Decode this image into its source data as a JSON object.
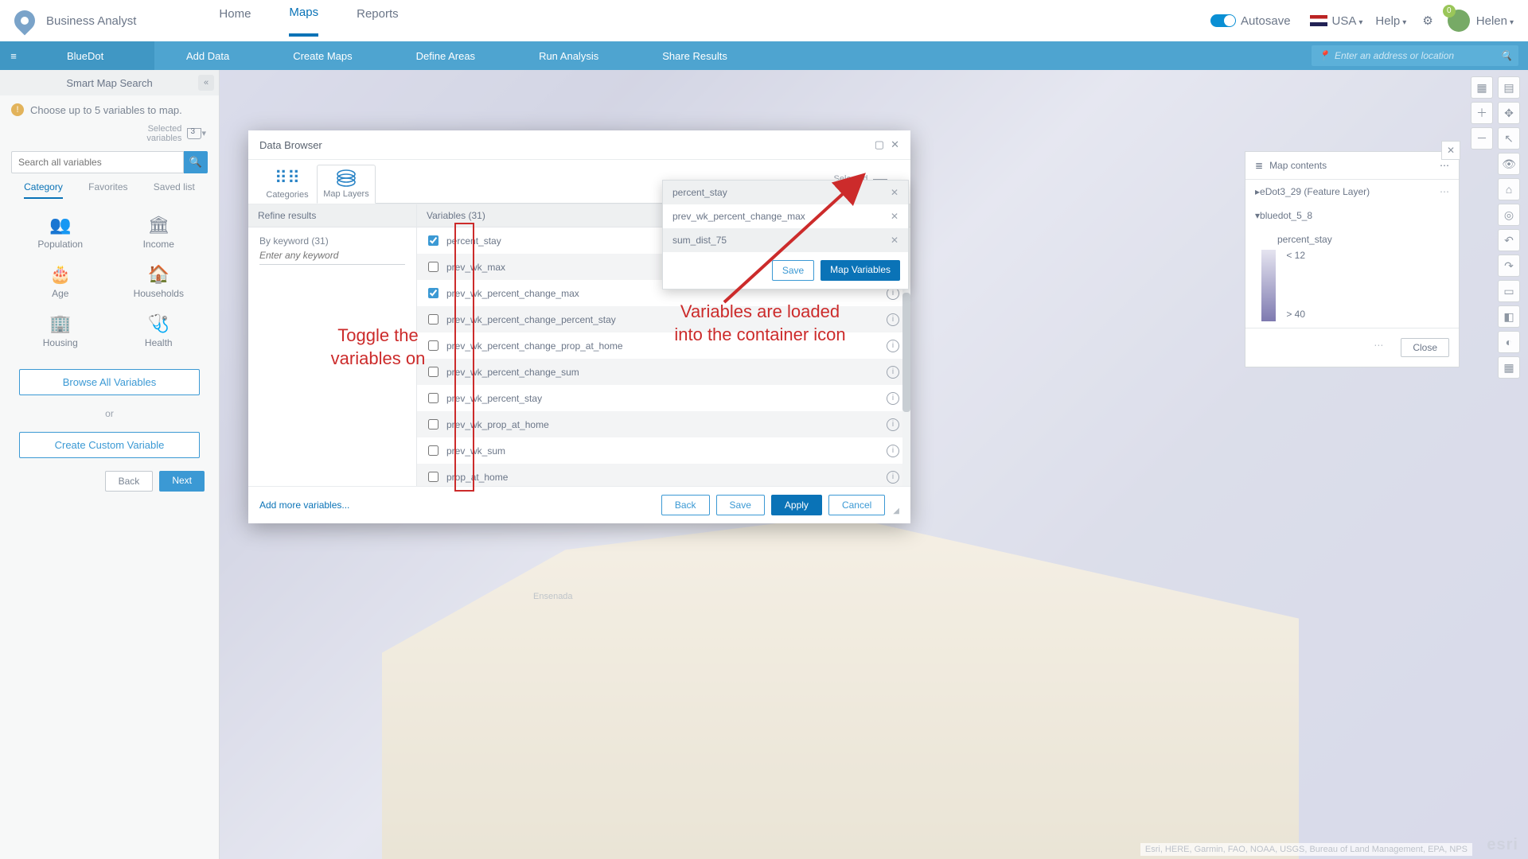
{
  "app": {
    "name": "Business Analyst"
  },
  "header": {
    "nav": [
      "Home",
      "Maps",
      "Reports"
    ],
    "active_index": 1,
    "autosave": "Autosave",
    "region": "USA",
    "help": "Help",
    "user": "Helen",
    "badge": "0"
  },
  "ribbon": {
    "hamburger": "≡",
    "title": "BlueDot",
    "items": [
      "Add Data",
      "Create Maps",
      "Define Areas",
      "Run Analysis",
      "Share Results"
    ],
    "search_placeholder": "Enter an address or location"
  },
  "leftpanel": {
    "title": "Smart Map Search",
    "hint": "Choose up to 5 variables to map.",
    "selected_label": "Selected\nvariables",
    "selected_count": "3",
    "search_placeholder": "Search all variables",
    "tabs": [
      "Category",
      "Favorites",
      "Saved list"
    ],
    "cats": [
      {
        "icon": "👥",
        "label": "Population"
      },
      {
        "icon": "🏛",
        "label": "Income"
      },
      {
        "icon": "🎂",
        "label": "Age"
      },
      {
        "icon": "🏠",
        "label": "Households"
      },
      {
        "icon": "🏢",
        "label": "Housing"
      },
      {
        "icon": "🩺",
        "label": "Health"
      }
    ],
    "browse": "Browse All Variables",
    "or": "or",
    "custom": "Create Custom Variable",
    "back": "Back",
    "next": "Next"
  },
  "modal": {
    "title": "Data Browser",
    "tabs": [
      {
        "label": "Categories",
        "icon": "⋮⋮⋮"
      },
      {
        "label": "Map Layers",
        "icon": "◈"
      }
    ],
    "active_tab": 1,
    "selected_label": "Selected\nvariables",
    "selected_count": "3",
    "refine_hd": "Refine results",
    "vars_hd": "Variables (31)",
    "keyword_label": "By keyword (31)",
    "keyword_placeholder": "Enter any keyword",
    "variables": [
      {
        "name": "percent_stay",
        "checked": true,
        "info": false
      },
      {
        "name": "prev_wk_max",
        "checked": false,
        "info": false
      },
      {
        "name": "prev_wk_percent_change_max",
        "checked": true,
        "info": true
      },
      {
        "name": "prev_wk_percent_change_percent_stay",
        "checked": false,
        "info": true
      },
      {
        "name": "prev_wk_percent_change_prop_at_home",
        "checked": false,
        "info": true
      },
      {
        "name": "prev_wk_percent_change_sum",
        "checked": false,
        "info": true
      },
      {
        "name": "prev_wk_percent_stay",
        "checked": false,
        "info": true
      },
      {
        "name": "prev_wk_prop_at_home",
        "checked": false,
        "info": true
      },
      {
        "name": "prev_wk_sum",
        "checked": false,
        "info": true
      },
      {
        "name": "prop_at_home",
        "checked": false,
        "info": true
      }
    ],
    "add_more": "Add more variables...",
    "footer": {
      "back": "Back",
      "save": "Save",
      "apply": "Apply",
      "cancel": "Cancel"
    }
  },
  "popover": {
    "items": [
      "percent_stay",
      "prev_wk_percent_change_max",
      "sum_dist_75"
    ],
    "save": "Save",
    "map": "Map Variables"
  },
  "mapcontents": {
    "title": "Map contents",
    "layers": [
      "eDot3_29 (Feature Layer)",
      "bluedot_5_8"
    ],
    "legend_var": "percent_stay",
    "legend_min": "< 12",
    "legend_max": "> 40",
    "close": "Close"
  },
  "annotations": {
    "left": "Toggle the\nvariables on",
    "right": "Variables are loaded\ninto the container icon"
  },
  "attribution": "Esri, HERE, Garmin, FAO, NOAA, USGS, Bureau of Land Management, EPA, NPS",
  "esri": "esri",
  "map_city": "Ensenada"
}
